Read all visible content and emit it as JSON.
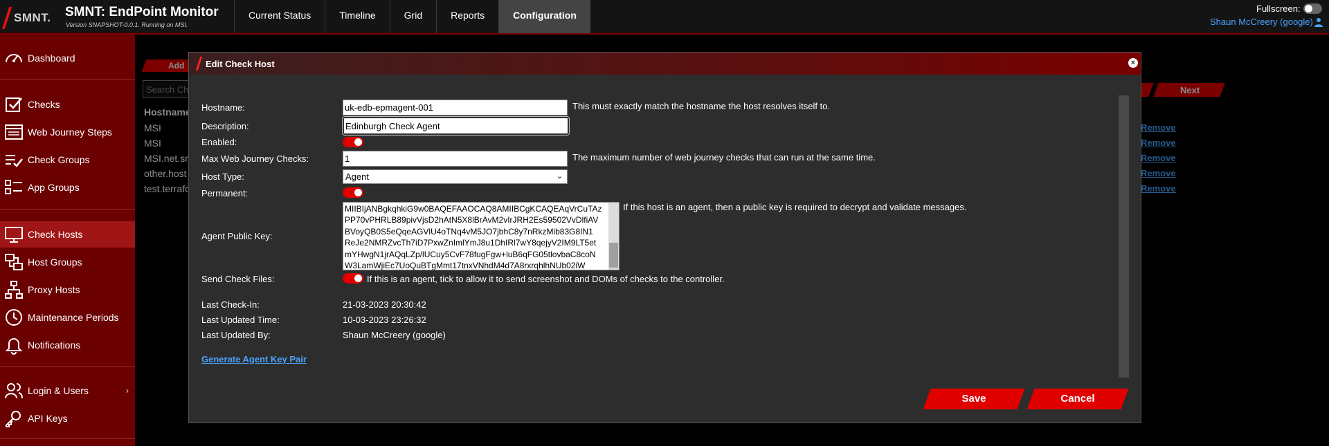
{
  "app": {
    "logo_text": "SMNT.",
    "title": "SMNT: EndPoint Monitor",
    "version_line": "Version SNAPSHOT-0.0.1. Running on MSI."
  },
  "nav": {
    "items": [
      {
        "label": "Current Status"
      },
      {
        "label": "Timeline"
      },
      {
        "label": "Grid"
      },
      {
        "label": "Reports"
      },
      {
        "label": "Configuration"
      }
    ],
    "active": "Configuration"
  },
  "header": {
    "fullscreen_label": "Fullscreen:",
    "fullscreen_on": false,
    "user_name": "Shaun McCreery (google)"
  },
  "sidebar": {
    "items": [
      {
        "label": "Dashboard",
        "icon": "dashboard-icon"
      },
      {
        "label": "Checks",
        "icon": "checks-icon"
      },
      {
        "label": "Web Journey Steps",
        "icon": "web-journey-icon"
      },
      {
        "label": "Check Groups",
        "icon": "check-groups-icon"
      },
      {
        "label": "App Groups",
        "icon": "app-groups-icon"
      },
      {
        "label": "Check Hosts",
        "icon": "monitor-icon"
      },
      {
        "label": "Host Groups",
        "icon": "host-groups-icon"
      },
      {
        "label": "Proxy Hosts",
        "icon": "network-icon"
      },
      {
        "label": "Maintenance Periods",
        "icon": "clock-icon"
      },
      {
        "label": "Notifications",
        "icon": "bell-icon"
      },
      {
        "label": "Login & Users",
        "icon": "users-icon"
      },
      {
        "label": "API Keys",
        "icon": "key-icon"
      }
    ],
    "active": "Check Hosts"
  },
  "background": {
    "add_label": "Add",
    "search_placeholder": "Search Checks",
    "column_header": "Hostname",
    "rows": [
      "MSI",
      "MSI",
      "MSI.net.smnt",
      "other.host",
      "test.terraform"
    ],
    "remove_label": "Remove",
    "next_label": "Next"
  },
  "modal": {
    "title": "Edit Check Host",
    "fields": {
      "hostname": {
        "label": "Hostname:",
        "value": "uk-edb-epmagent-001",
        "hint": "This must exactly match the hostname the host resolves itself to."
      },
      "description": {
        "label": "Description:",
        "value": "Edinburgh Check Agent"
      },
      "enabled": {
        "label": "Enabled:",
        "on": true
      },
      "max_web": {
        "label": "Max Web Journey Checks:",
        "value": "1",
        "hint": "The maximum number of web journey checks that can run at the same time."
      },
      "host_type": {
        "label": "Host Type:",
        "value": "Agent"
      },
      "permanent": {
        "label": "Permanent:",
        "on": true
      },
      "public_key": {
        "label": "Agent Public Key:",
        "hint": "If this host is an agent, then a public key is required to decrypt and validate messages.",
        "lines": [
          "MIIBIjANBgkqhkiG9w0BAQEFAAOCAQ8AMIIBCgKCAQEAqVrCuTAz",
          "PP70vPHRLB89pivVjsD2hAtN5X8lBrAvM2vIrJRH2Es59502VvDlfiAV",
          "BVoyQB0S5eQqeAGVlU4oTNq4vM5JO7jbhC8y7nRkzMib83G8IN1",
          "ReJe2NMRZvcTh7iD7PxwZnImlYmJ8u1DhIRl7wY8qejyV2IM9LT5et",
          "mYHwgN1jrAQqLZp/lUCuy5CvF78fugFgw+luB6qFG05tlovbaC8coN",
          "W3LamWjiEc7UoQuBTgMmt17tnxVNhdM4d7A8rxrqhlhNUb02iW"
        ]
      },
      "send_files": {
        "label": "Send Check Files:",
        "on": true,
        "hint": "If this is an agent, tick to allow it to send screenshot and DOMs of checks to the controller."
      },
      "last_checkin": {
        "label": "Last Check-In:",
        "value": "21-03-2023 20:30:42"
      },
      "last_updated_time": {
        "label": "Last Updated Time:",
        "value": "10-03-2023 23:26:32"
      },
      "last_updated_by": {
        "label": "Last Updated By:",
        "value": "Shaun McCreery (google)"
      }
    },
    "generate_link": "Generate Agent Key Pair",
    "save_label": "Save",
    "cancel_label": "Cancel"
  },
  "colors": {
    "accent_red": "#e00000",
    "sidebar_bg": "#6b0000",
    "link_blue": "#4aa3ff"
  }
}
